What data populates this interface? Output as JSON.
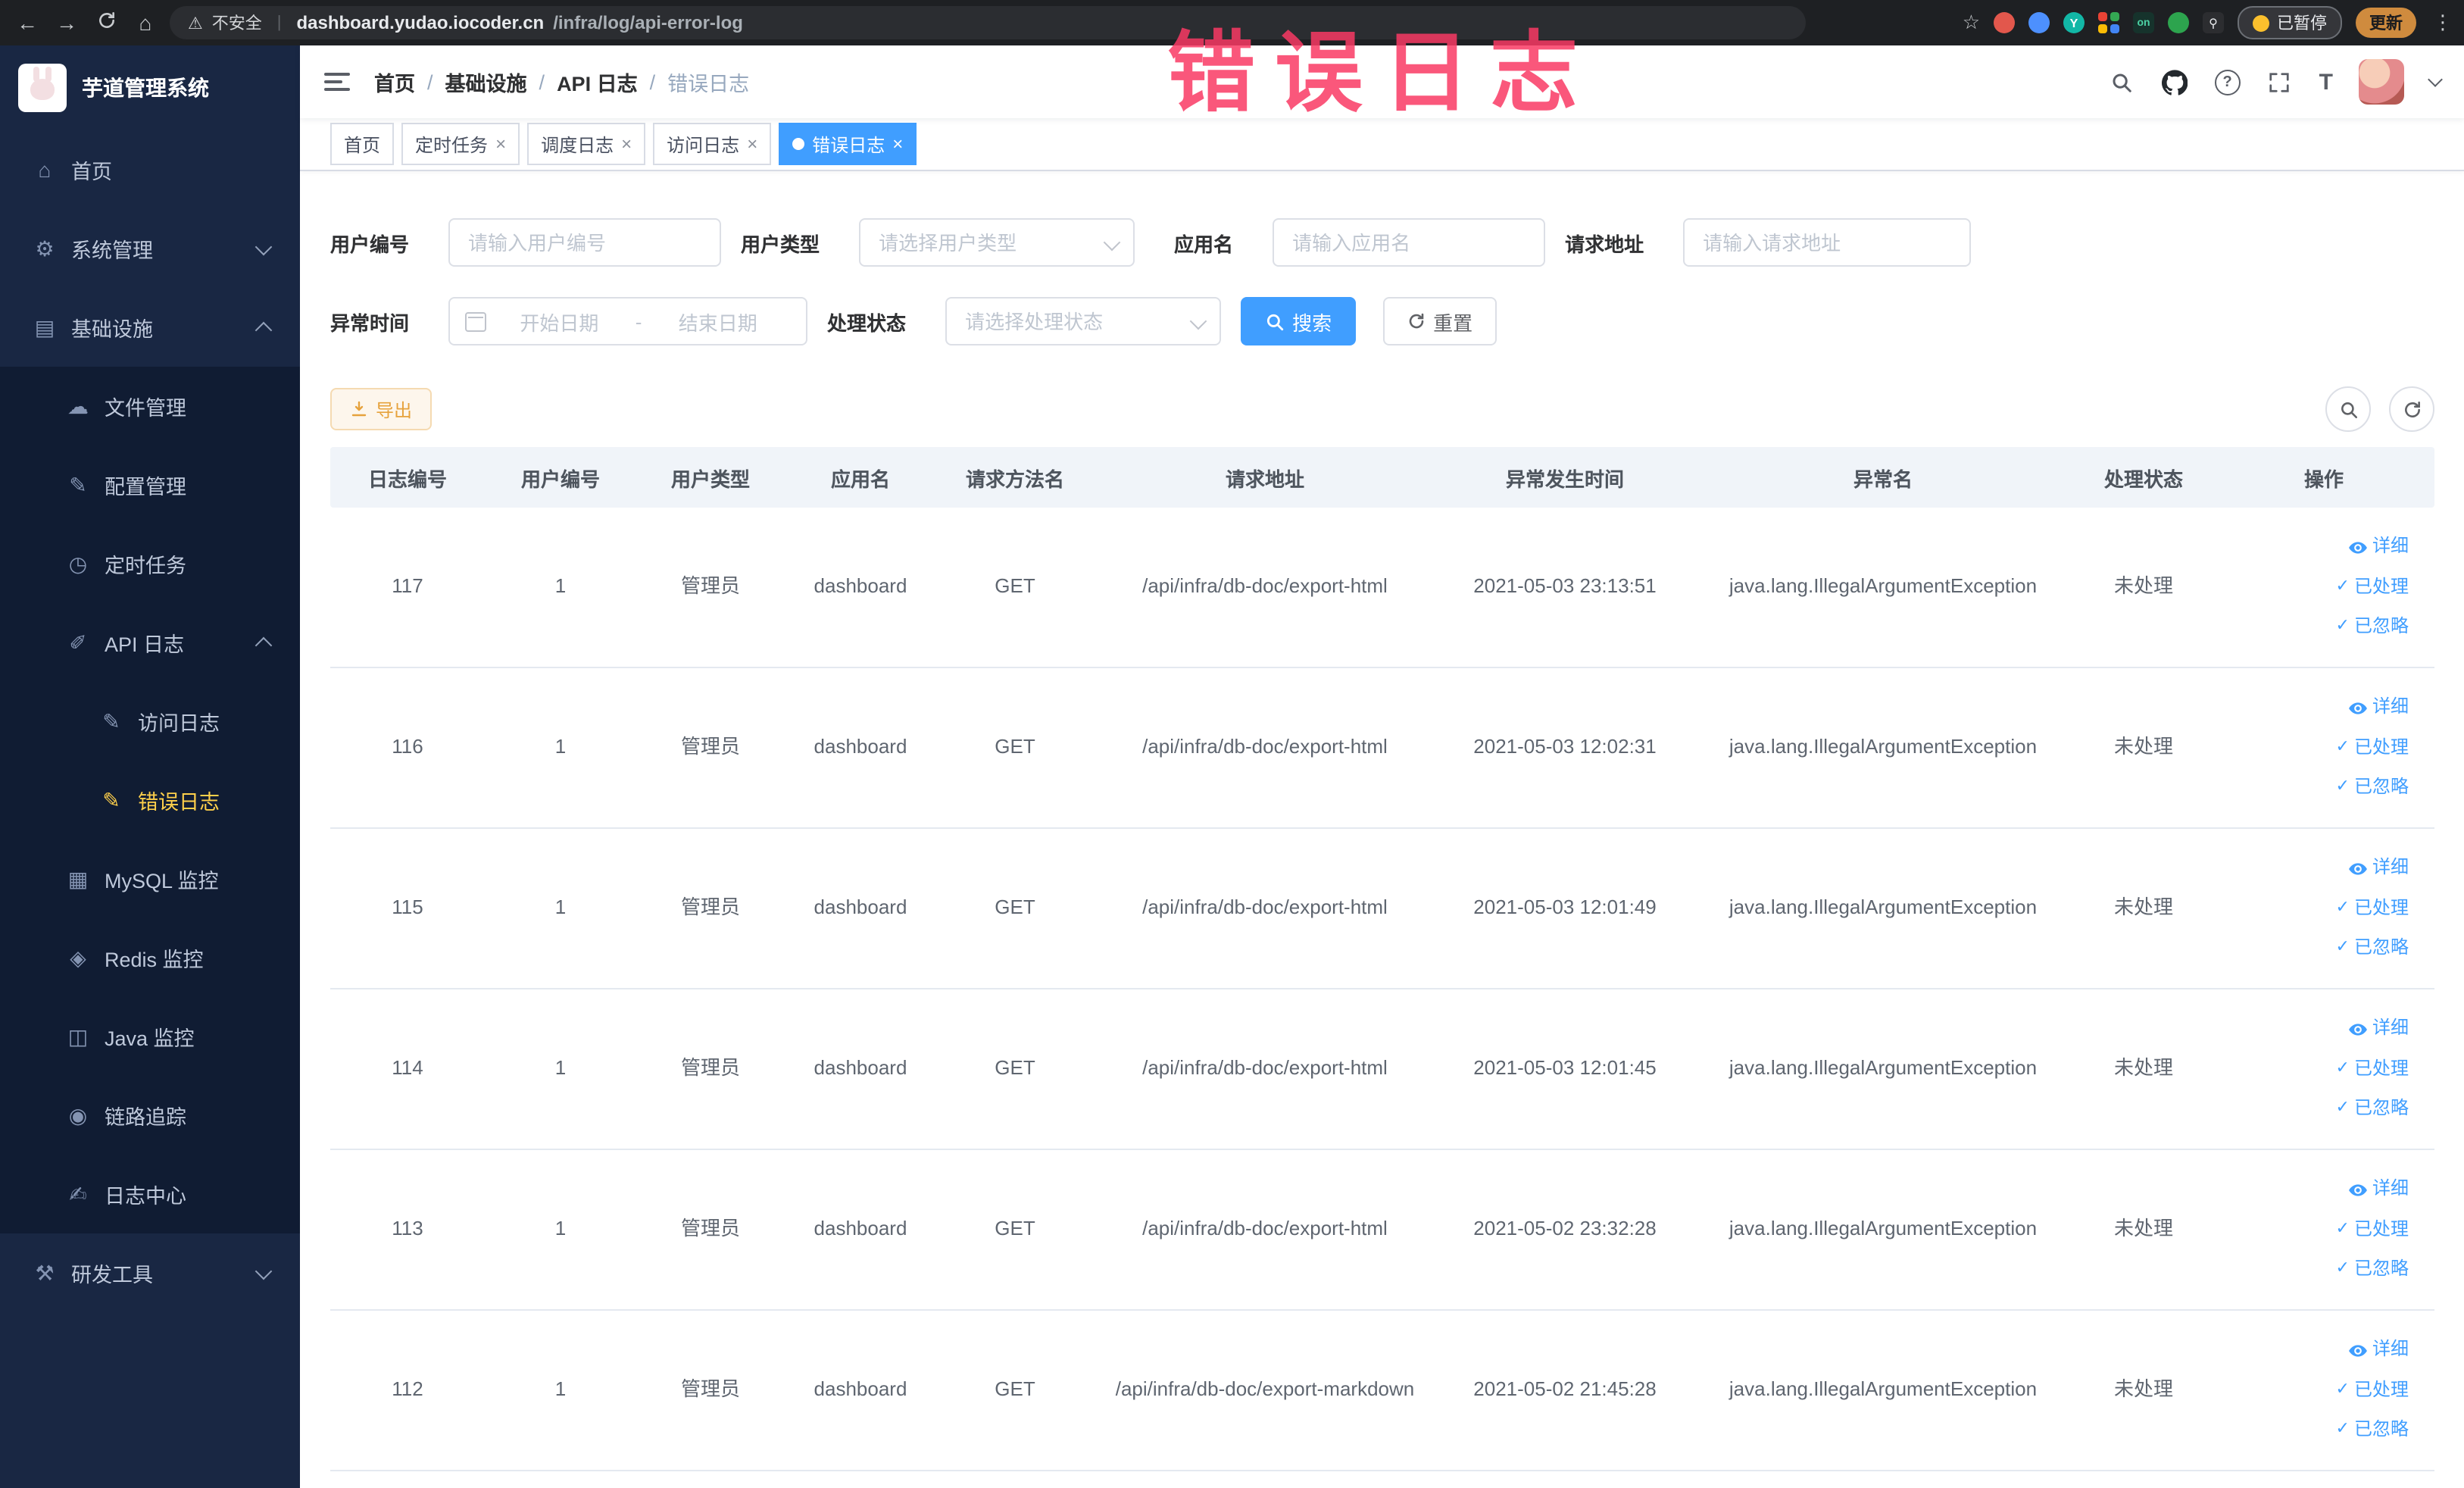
{
  "watermark": "错误日志",
  "browser": {
    "security_label": "不安全",
    "url_host": "dashboard.yudao.iocoder.cn",
    "url_path": "/infra/log/api-error-log",
    "extension_badge": "on",
    "extension_y": "Y",
    "paused_label": "已暂停",
    "update_label": "更新"
  },
  "icons": {
    "back": "←",
    "forward": "→",
    "home_chrome": "⌂",
    "star": "☆",
    "more": "⋮",
    "warning": "⚠",
    "divider": "|",
    "close": "×",
    "check": "✓",
    "home": "⌂",
    "system": "⚙",
    "infra": "▤",
    "file": "☁",
    "config": "✎",
    "job": "◷",
    "apilog": "✐",
    "access": "✎",
    "error": "✎",
    "mysql": "▦",
    "redis": "◈",
    "java": "◫",
    "trace": "◉",
    "logcenter": "✍",
    "tools": "⚒",
    "font_size": "T"
  },
  "sidebar": {
    "logo_title": "芋道管理系统",
    "items": [
      {
        "label": "首页"
      },
      {
        "label": "系统管理"
      },
      {
        "label": "基础设施"
      },
      {
        "label": "文件管理"
      },
      {
        "label": "配置管理"
      },
      {
        "label": "定时任务"
      },
      {
        "label": "API 日志"
      },
      {
        "label": "访问日志"
      },
      {
        "label": "错误日志"
      },
      {
        "label": "MySQL 监控"
      },
      {
        "label": "Redis 监控"
      },
      {
        "label": "Java 监控"
      },
      {
        "label": "链路追踪"
      },
      {
        "label": "日志中心"
      },
      {
        "label": "研发工具"
      }
    ]
  },
  "breadcrumb": {
    "separator": "/",
    "items": [
      "首页",
      "基础设施",
      "API 日志",
      "错误日志"
    ]
  },
  "tabs": [
    {
      "label": "首页"
    },
    {
      "label": "定时任务"
    },
    {
      "label": "调度日志"
    },
    {
      "label": "访问日志"
    },
    {
      "label": "错误日志"
    }
  ],
  "filters": {
    "user_id_label": "用户编号",
    "user_id_placeholder": "请输入用户编号",
    "user_type_label": "用户类型",
    "user_type_placeholder": "请选择用户类型",
    "app_name_label": "应用名",
    "app_name_placeholder": "请输入应用名",
    "request_url_label": "请求地址",
    "request_url_placeholder": "请输入请求地址",
    "exception_time_label": "异常时间",
    "date_start_placeholder": "开始日期",
    "date_separator": "-",
    "date_end_placeholder": "结束日期",
    "process_status_label": "处理状态",
    "process_status_placeholder": "请选择处理状态",
    "search_label": "搜索",
    "reset_label": "重置"
  },
  "toolbar": {
    "export_label": "导出"
  },
  "table": {
    "columns": [
      "日志编号",
      "用户编号",
      "用户类型",
      "应用名",
      "请求方法名",
      "请求地址",
      "异常发生时间",
      "异常名",
      "处理状态",
      "操作"
    ],
    "actions": {
      "detail": "详细",
      "processed": "已处理",
      "ignored": "已忽略"
    },
    "rows": [
      {
        "id": "117",
        "user_id": "1",
        "user_type": "管理员",
        "app": "dashboard",
        "method": "GET",
        "url": "/api/infra/db-doc/export-html",
        "time": "2021-05-03 23:13:51",
        "exception": "java.lang.IllegalArgumentException",
        "status": "未处理"
      },
      {
        "id": "116",
        "user_id": "1",
        "user_type": "管理员",
        "app": "dashboard",
        "method": "GET",
        "url": "/api/infra/db-doc/export-html",
        "time": "2021-05-03 12:02:31",
        "exception": "java.lang.IllegalArgumentException",
        "status": "未处理"
      },
      {
        "id": "115",
        "user_id": "1",
        "user_type": "管理员",
        "app": "dashboard",
        "method": "GET",
        "url": "/api/infra/db-doc/export-html",
        "time": "2021-05-03 12:01:49",
        "exception": "java.lang.IllegalArgumentException",
        "status": "未处理"
      },
      {
        "id": "114",
        "user_id": "1",
        "user_type": "管理员",
        "app": "dashboard",
        "method": "GET",
        "url": "/api/infra/db-doc/export-html",
        "time": "2021-05-03 12:01:45",
        "exception": "java.lang.IllegalArgumentException",
        "status": "未处理"
      },
      {
        "id": "113",
        "user_id": "1",
        "user_type": "管理员",
        "app": "dashboard",
        "method": "GET",
        "url": "/api/infra/db-doc/export-html",
        "time": "2021-05-02 23:32:28",
        "exception": "java.lang.IllegalArgumentException",
        "status": "未处理"
      },
      {
        "id": "112",
        "user_id": "1",
        "user_type": "管理员",
        "app": "dashboard",
        "method": "GET",
        "url": "/api/infra/db-doc/export-markdown",
        "time": "2021-05-02 21:45:28",
        "exception": "java.lang.IllegalArgumentException",
        "status": "未处理"
      }
    ]
  }
}
